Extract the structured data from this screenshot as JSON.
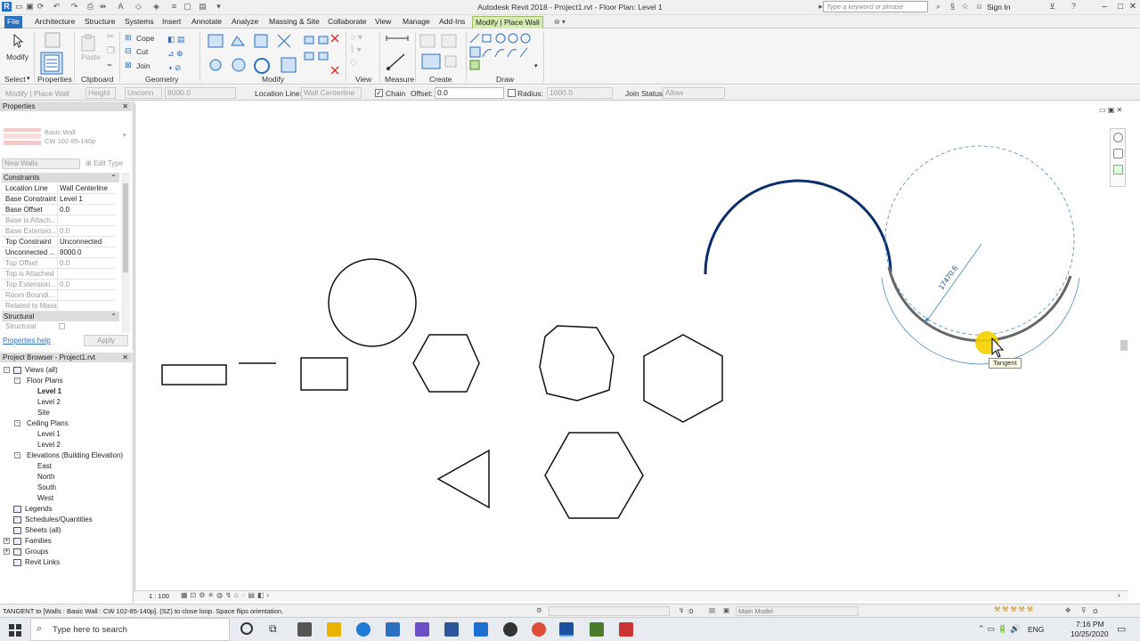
{
  "window": {
    "title": "Autodesk Revit 2018 -    Project1.rvt - Floor Plan: Level 1",
    "search_placeholder": "Type a keyword or phrase",
    "sign_in": "Sign In"
  },
  "tabs": [
    "File",
    "Architecture",
    "Structure",
    "Systems",
    "Insert",
    "Annotate",
    "Analyze",
    "Massing & Site",
    "Collaborate",
    "View",
    "Manage",
    "Add-Ins",
    "Modify | Place Wall"
  ],
  "ribbon": {
    "modify": "Modify",
    "paste": "Paste",
    "cope": "Cope",
    "cut": "Cut",
    "join": "Join",
    "panels": {
      "select": "Select",
      "properties": "Properties",
      "clipboard": "Clipboard",
      "geometry": "Geometry",
      "modify": "Modify",
      "view": "View",
      "measure": "Measure",
      "create": "Create",
      "draw": "Draw"
    }
  },
  "options_bar": {
    "context": "Modify | Place Wall",
    "height_label": "Height",
    "height_mode": "Unconn",
    "height_value": "8000.0",
    "location_line_label": "Location Line:",
    "location_line_value": "Wall Centerline",
    "chain_label": "Chain",
    "offset_label": "Offset:",
    "offset_value": "0.0",
    "radius_label": "Radius:",
    "radius_value": "1000.0",
    "join_status_label": "Join Status:",
    "join_status_value": "Allow"
  },
  "properties": {
    "title": "Properties",
    "type_name_line1": "Basic Wall",
    "type_name_line2": "CW 102-85-140p",
    "filter": "New Walls",
    "edit_type": "Edit Type",
    "section_constraints": "Constraints",
    "rows": [
      {
        "k": "Location Line",
        "v": "Wall Centerline",
        "dim": false
      },
      {
        "k": "Base Constraint",
        "v": "Level 1",
        "dim": false
      },
      {
        "k": "Base Offset",
        "v": "0.0",
        "dim": false
      },
      {
        "k": "Base is Attach...",
        "v": "",
        "dim": true
      },
      {
        "k": "Base Extensio...",
        "v": "0.0",
        "dim": true
      },
      {
        "k": "Top Constraint",
        "v": "Unconnected",
        "dim": false
      },
      {
        "k": "Unconnected ...",
        "v": "8000.0",
        "dim": false
      },
      {
        "k": "Top Offset",
        "v": "0.0",
        "dim": true
      },
      {
        "k": "Top is Attached",
        "v": "",
        "dim": true
      },
      {
        "k": "Top Extension...",
        "v": "0.0",
        "dim": true
      },
      {
        "k": "Room Boundi...",
        "v": "",
        "dim": true
      },
      {
        "k": "Related to Mass",
        "v": "",
        "dim": true
      }
    ],
    "section_structural": "Structural",
    "structural_row": "Structural",
    "help_link": "Properties help",
    "apply": "Apply"
  },
  "browser": {
    "title": "Project Browser - Project1.rvt",
    "items": [
      {
        "label": "Views (all)",
        "level": 0,
        "toggle": "-"
      },
      {
        "label": "Floor Plans",
        "level": 1,
        "toggle": "-"
      },
      {
        "label": "Level 1",
        "level": 2,
        "toggle": "",
        "bold": true
      },
      {
        "label": "Level 2",
        "level": 2,
        "toggle": ""
      },
      {
        "label": "Site",
        "level": 2,
        "toggle": ""
      },
      {
        "label": "Ceiling Plans",
        "level": 1,
        "toggle": "-"
      },
      {
        "label": "Level 1",
        "level": 2,
        "toggle": ""
      },
      {
        "label": "Level 2",
        "level": 2,
        "toggle": ""
      },
      {
        "label": "Elevations (Building Elevation)",
        "level": 1,
        "toggle": "-"
      },
      {
        "label": "East",
        "level": 2,
        "toggle": ""
      },
      {
        "label": "North",
        "level": 2,
        "toggle": ""
      },
      {
        "label": "South",
        "level": 2,
        "toggle": ""
      },
      {
        "label": "West",
        "level": 2,
        "toggle": ""
      },
      {
        "label": "Legends",
        "level": 0,
        "toggle": ""
      },
      {
        "label": "Schedules/Quantities",
        "level": 0,
        "toggle": ""
      },
      {
        "label": "Sheets (all)",
        "level": 0,
        "toggle": ""
      },
      {
        "label": "Families",
        "level": 0,
        "toggle": "+"
      },
      {
        "label": "Groups",
        "level": 0,
        "toggle": "+"
      },
      {
        "label": "Revit Links",
        "level": 0,
        "toggle": ""
      }
    ]
  },
  "canvas": {
    "dimension": "17470.6",
    "tooltip": "Tangent"
  },
  "view_bar": {
    "scale": "1 : 100"
  },
  "status": {
    "message": "TANGENT  to [Walls : Basic Wall : CW 102-85-140p]. (SZ) to close loop. Space flips orientation.",
    "zero": ":0",
    "workset": "Main Model",
    "filter_count": ":0"
  },
  "taskbar": {
    "search": "Type here to search",
    "lang": "ENG",
    "time": "7:16 PM",
    "date": "10/25/2020"
  },
  "colors": {
    "accent": "#2b6fc1",
    "active_tab": "#d6ecb2",
    "wall": "#0b2d6b",
    "highlight": "#f5d000"
  }
}
